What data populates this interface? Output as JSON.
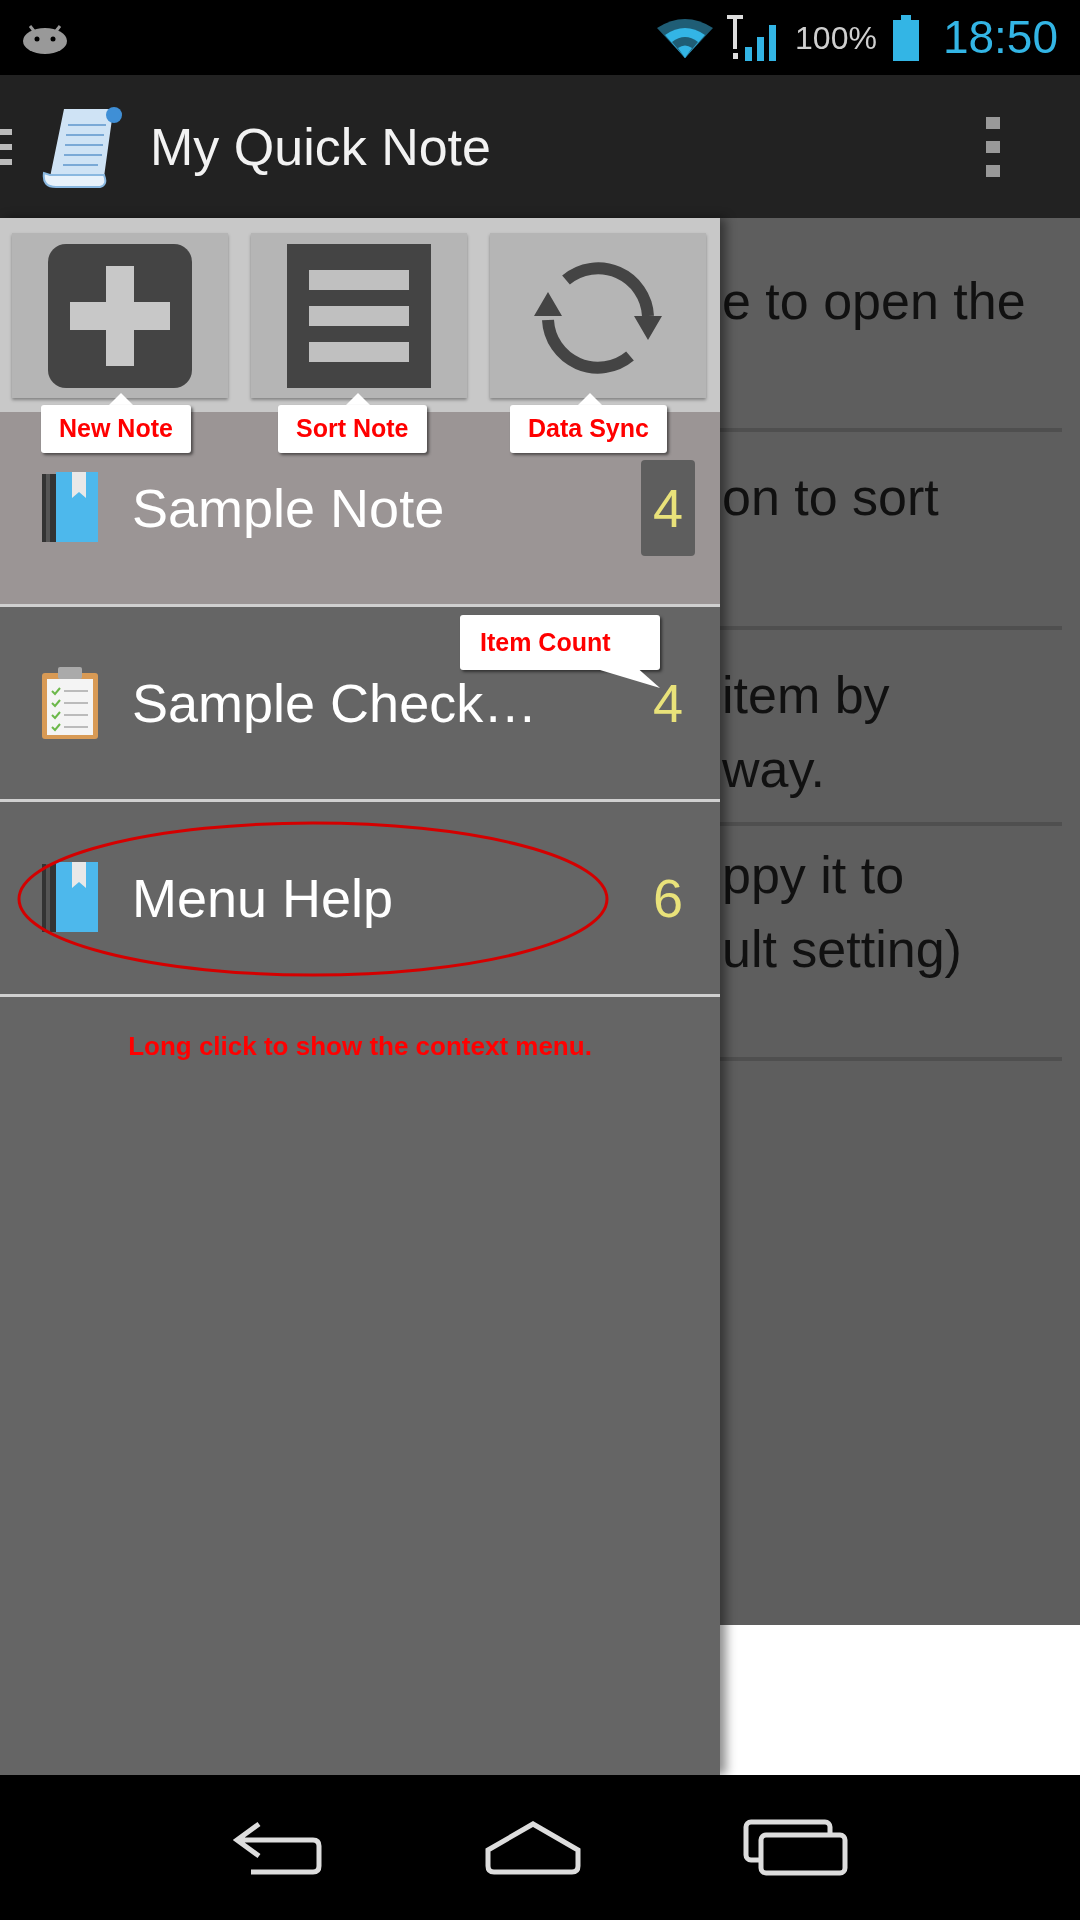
{
  "status_bar": {
    "battery_text": "100%",
    "time": "18:50"
  },
  "action_bar": {
    "title": "My Quick Note"
  },
  "drawer": {
    "buttons": [
      {
        "kind": "add",
        "callout": "New Note"
      },
      {
        "kind": "sort",
        "callout": "Sort Note"
      },
      {
        "kind": "sync",
        "callout": "Data Sync"
      }
    ],
    "items": [
      {
        "kind": "note",
        "title": "Sample Note",
        "count": "4",
        "selected": true,
        "circled": false
      },
      {
        "kind": "checklist",
        "title": "Sample Check…",
        "count": "4",
        "selected": false,
        "circled": false,
        "callout": "Item Count"
      },
      {
        "kind": "note",
        "title": "Menu Help",
        "count": "6",
        "selected": false,
        "circled": true
      }
    ],
    "hint": "Long click to show the context menu."
  },
  "content": {
    "items": [
      {
        "lines": [
          "e to open the"
        ]
      },
      {
        "lines": [
          "on to sort"
        ]
      },
      {
        "lines": [
          "item by",
          "way."
        ]
      },
      {
        "lines": [
          "ppy it to",
          "ult setting)"
        ]
      }
    ]
  }
}
